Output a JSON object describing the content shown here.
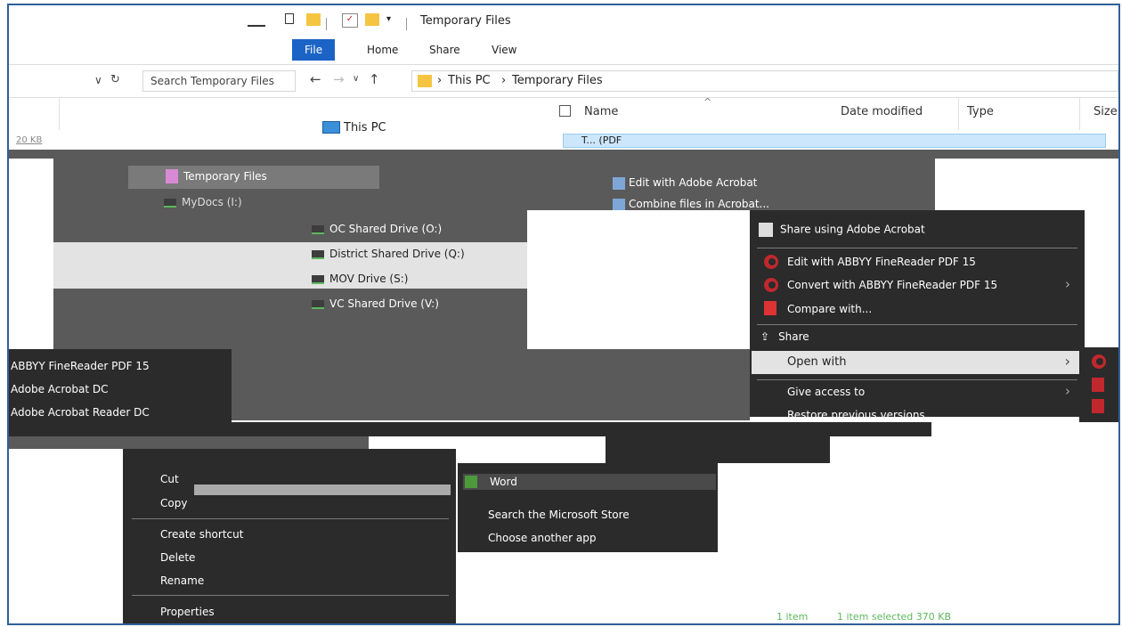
{
  "window": {
    "title": "Temporary Files"
  },
  "ribbon": {
    "tabs": [
      "File",
      "Home",
      "Share",
      "View"
    ]
  },
  "address": {
    "search_placeholder": "Search Temporary Files",
    "breadcrumb": [
      "This PC",
      "Temporary Files"
    ]
  },
  "left_sidebar": {
    "size_text": "20 KB"
  },
  "file_list": {
    "columns": [
      "Name",
      "Date modified",
      "Type",
      "Size"
    ],
    "first_file_partial": "T... (PDF"
  },
  "nav_pane": {
    "this_pc": "This PC",
    "temporary_files": "Temporary Files",
    "mydocs": "MyDocs (I:)",
    "drives": [
      "OC Shared Drive (O:)",
      "District Shared Drive (Q:)",
      "MOV Drive (S:)",
      "VC Shared Drive (V:)"
    ]
  },
  "acrobat_menu": {
    "edit": "Edit with Adobe Acrobat",
    "combine": "Combine files in Acrobat..."
  },
  "context_menu": {
    "share_acrobat": "Share using Adobe Acrobat",
    "edit_finereader": "Edit with ABBYY FineReader PDF 15",
    "convert_finereader": "Convert with ABBYY FineReader PDF 15",
    "compare": "Compare with...",
    "share": "Share",
    "open_with": "Open with",
    "give_access": "Give access to",
    "restore": "Restore previous versions"
  },
  "open_with_list": [
    "ABBYY FineReader PDF 15",
    "Adobe Acrobat DC",
    "Adobe Acrobat Reader DC"
  ],
  "bottom_menu": {
    "cut": "Cut",
    "copy": "Copy",
    "create_shortcut": "Create shortcut",
    "delete": "Delete",
    "rename": "Rename",
    "properties": "Properties"
  },
  "app_menu": {
    "word": "Word",
    "search_store": "Search the Microsoft Store",
    "choose_app": "Choose another app"
  },
  "status_bar": {
    "items": "1 item",
    "selected": "1 item selected 370 KB"
  },
  "colors": {
    "accent": "#1b63c5",
    "menu_dark": "#2b2b2b",
    "menu_mid": "#5a5a5a",
    "highlight": "#e3e3e3",
    "status_green": "#5cb85c"
  }
}
